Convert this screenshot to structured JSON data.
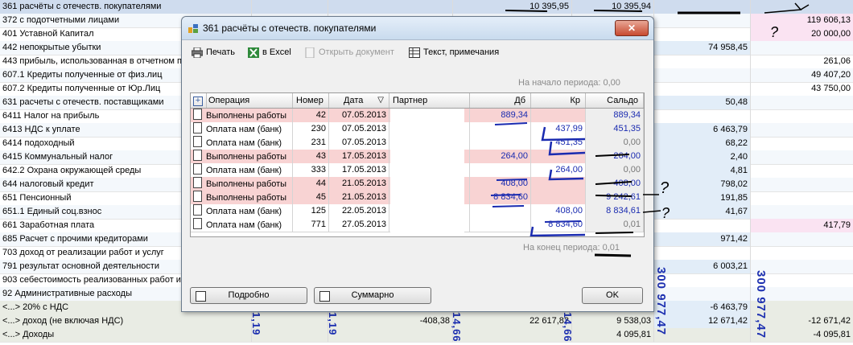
{
  "background": {
    "rows": [
      {
        "name": "361 расчёты с отечеств. покупателями",
        "c3": "10 395,95",
        "c4": "10 395,94",
        "style": "sel"
      },
      {
        "name": "372 с подотчетными лицами",
        "c6": "119 606,13",
        "pink6": true
      },
      {
        "name": "401 Уставной Капитал",
        "c6": "20 000,00",
        "pink6": true
      },
      {
        "name": "442 непокрытые убытки",
        "c5": "74 958,45"
      },
      {
        "name": "443 прибыль, использованная в отчетном п",
        "c6": "261,06"
      },
      {
        "name": "607.1 Кредиты полученные от физ.лиц",
        "c6": "49 407,20"
      },
      {
        "name": "607.2 Кредиты полученные от Юр.Лиц",
        "c6": "43 750,00"
      },
      {
        "name": "631 расчеты с отечеств. поставщиками",
        "c5": "50,48"
      },
      {
        "name": "6411 Налог на прибыль"
      },
      {
        "name": "6413 НДС к уплате",
        "c5": "6 463,79"
      },
      {
        "name": "6414 подоходный",
        "c5": "68,22"
      },
      {
        "name": "6415 Коммунальный налог",
        "c5": "2,40"
      },
      {
        "name": "642.2 Охрана окружающей среды",
        "c5": "4,81"
      },
      {
        "name": "644 налоговый кредит",
        "c5": "798,02"
      },
      {
        "name": "651 Пенсионный",
        "c5": "191,85"
      },
      {
        "name": "651.1 Единый соц.взнос",
        "c5": "41,67"
      },
      {
        "name": "661 Заработная плата",
        "c6": "417,79",
        "pink6": true
      },
      {
        "name": "685 Расчет с прочими кредиторами",
        "c5": "971,42"
      },
      {
        "name": "703 доход от реализации работ и услуг"
      },
      {
        "name": "791 результат основной деятельности",
        "c5": "6 003,21"
      },
      {
        "name": "903 себестоимость реализованных работ и"
      },
      {
        "name": "92 Административные расходы"
      },
      {
        "name": "<...> 20% с НДС",
        "c5": "-6 463,79",
        "style": "sum"
      },
      {
        "name": "<...> доход (не включая НДС)",
        "c2": "-408,38",
        "c3": "22 617,82",
        "c4": "9 538,03",
        "c5": "12 671,42",
        "c6": "-12 671,42",
        "style": "sum"
      },
      {
        "name": "<...> Доходы",
        "c4": "4 095,81",
        "c6": "-4 095,81",
        "style": "sum"
      }
    ],
    "vertical_labels": [
      "300 977,47",
      "300 977,47",
      "1,19",
      "1,19",
      "14,66",
      "14,66"
    ]
  },
  "dialog": {
    "title": "361 расчёты с отечеств. покупателями",
    "close_label": "✕",
    "toolbar": {
      "print": "Печать",
      "excel": "в Excel",
      "open_doc": "Открыть документ",
      "text_notes": "Текст, примечания"
    },
    "start_period": "На начало периода:  0,00",
    "end_period": "На конец периода:  0,01",
    "columns": {
      "add": "+",
      "operation": "Операция",
      "number": "Номер",
      "date": "Дата",
      "partner": "Партнер",
      "debit": "Дб",
      "credit": "Кр",
      "saldo": "Сальдо"
    },
    "rows": [
      {
        "op": "Выполнены работы",
        "num": "42",
        "date": "07.05.2013",
        "debit": "889,34",
        "credit": "",
        "saldo": "889,34",
        "pink": true
      },
      {
        "op": "Оплата нам (банк)",
        "num": "230",
        "date": "07.05.2013",
        "debit": "",
        "credit": "437,99",
        "saldo": "451,35",
        "pink": false
      },
      {
        "op": "Оплата нам (банк)",
        "num": "231",
        "date": "07.05.2013",
        "debit": "",
        "credit": "451,35",
        "saldo": "0,00",
        "pink": false
      },
      {
        "op": "Выполнены работы",
        "num": "43",
        "date": "17.05.2013",
        "debit": "264,00",
        "credit": "",
        "saldo": "264,00",
        "pink": true
      },
      {
        "op": "Оплата нам (банк)",
        "num": "333",
        "date": "17.05.2013",
        "debit": "",
        "credit": "264,00",
        "saldo": "0,00",
        "pink": false
      },
      {
        "op": "Выполнены работы",
        "num": "44",
        "date": "21.05.2013",
        "debit": "408,00",
        "credit": "",
        "saldo": "408,00",
        "pink": true
      },
      {
        "op": "Выполнены работы",
        "num": "45",
        "date": "21.05.2013",
        "debit": "8 834,60",
        "credit": "",
        "saldo": "9 242,61",
        "pink": true
      },
      {
        "op": "Оплата нам (банк)",
        "num": "125",
        "date": "22.05.2013",
        "debit": "",
        "credit": "408,00",
        "saldo": "8 834,61",
        "pink": false
      },
      {
        "op": "Оплата нам (банк)",
        "num": "771",
        "date": "27.05.2013",
        "debit": "",
        "credit": "8 834,60",
        "saldo": "0,01",
        "pink": false
      }
    ],
    "buttons": {
      "detailed": "Подробно",
      "summary": "Суммарно",
      "ok": "OK"
    }
  },
  "annotations": {
    "q1": "?",
    "q2": "?",
    "q3": "?"
  }
}
